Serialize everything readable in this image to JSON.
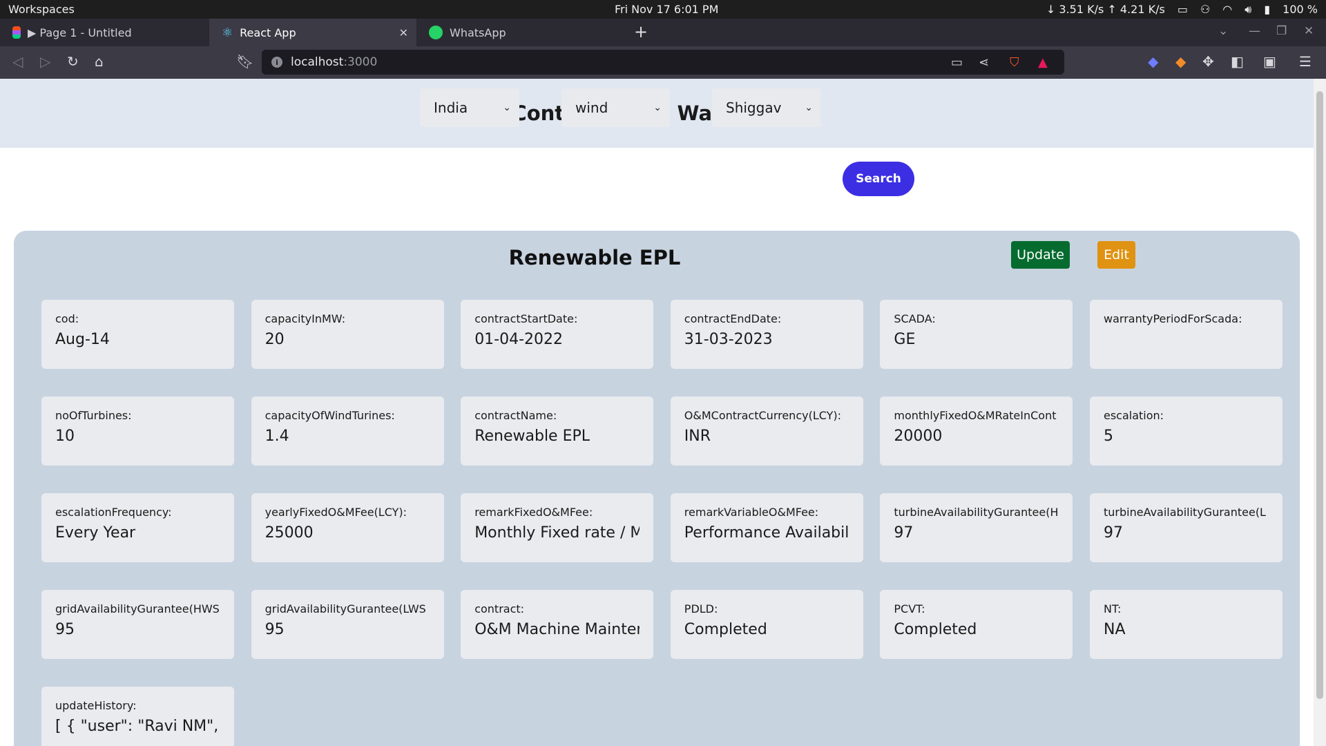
{
  "os": {
    "workspaces": "Workspaces",
    "clock": "Fri Nov 17   6:01 PM",
    "net_speed": "↓ 3.51 K/s ↑ 4.21 K/s",
    "battery": "100 %"
  },
  "tabs": [
    {
      "label": "▶ Page 1 - Untitled"
    },
    {
      "label": "React App"
    },
    {
      "label": "WhatsApp"
    }
  ],
  "address": {
    "host": "localhost",
    "port": ":3000"
  },
  "page": {
    "title": "Contracts and Warranties",
    "filters": {
      "country": "India",
      "type": "wind",
      "site": "Shiggav"
    },
    "search_label": "Search",
    "panel_title": "Renewable EPL",
    "update_label": "Update",
    "edit_label": "Edit",
    "fields": [
      {
        "label": "cod:",
        "value": "Aug-14"
      },
      {
        "label": "capacityInMW:",
        "value": "20"
      },
      {
        "label": "contractStartDate:",
        "value": "01-04-2022"
      },
      {
        "label": "contractEndDate:",
        "value": "31-03-2023"
      },
      {
        "label": "SCADA:",
        "value": "GE"
      },
      {
        "label": "warrantyPeriodForScada:",
        "value": ""
      },
      {
        "label": "noOfTurbines:",
        "value": "10"
      },
      {
        "label": "capacityOfWindTurines:",
        "value": "1.4"
      },
      {
        "label": "contractName:",
        "value": "Renewable EPL"
      },
      {
        "label": "O&MContractCurrency(LCY):",
        "value": "INR"
      },
      {
        "label": "monthlyFixedO&MRateInCont",
        "value": "20000"
      },
      {
        "label": "escalation:",
        "value": "5"
      },
      {
        "label": "escalationFrequency:",
        "value": "Every Year"
      },
      {
        "label": "yearlyFixedO&MFee(LCY):",
        "value": "25000"
      },
      {
        "label": "remarkFixedO&MFee:",
        "value": "Monthly Fixed rate / M"
      },
      {
        "label": "remarkVariableO&MFee:",
        "value": "Performance Availabili"
      },
      {
        "label": "turbineAvailabilityGurantee(H",
        "value": "97"
      },
      {
        "label": "turbineAvailabilityGurantee(L",
        "value": "97"
      },
      {
        "label": "gridAvailabilityGurantee(HWS",
        "value": "95"
      },
      {
        "label": "gridAvailabilityGurantee(LWS",
        "value": "95"
      },
      {
        "label": "contract:",
        "value": "O&M Machine Mainten"
      },
      {
        "label": "PDLD:",
        "value": "Completed"
      },
      {
        "label": "PCVT:",
        "value": "Completed"
      },
      {
        "label": "NT:",
        "value": "NA"
      },
      {
        "label": "updateHistory:",
        "value": "[ { \"user\": \"Ravi NM\", \"ti"
      }
    ]
  },
  "colors": {
    "search": "#3b2ee3",
    "update": "#056b2f",
    "edit": "#e09212",
    "panel": "#c8d3e0",
    "header": "#e0e7f1"
  }
}
